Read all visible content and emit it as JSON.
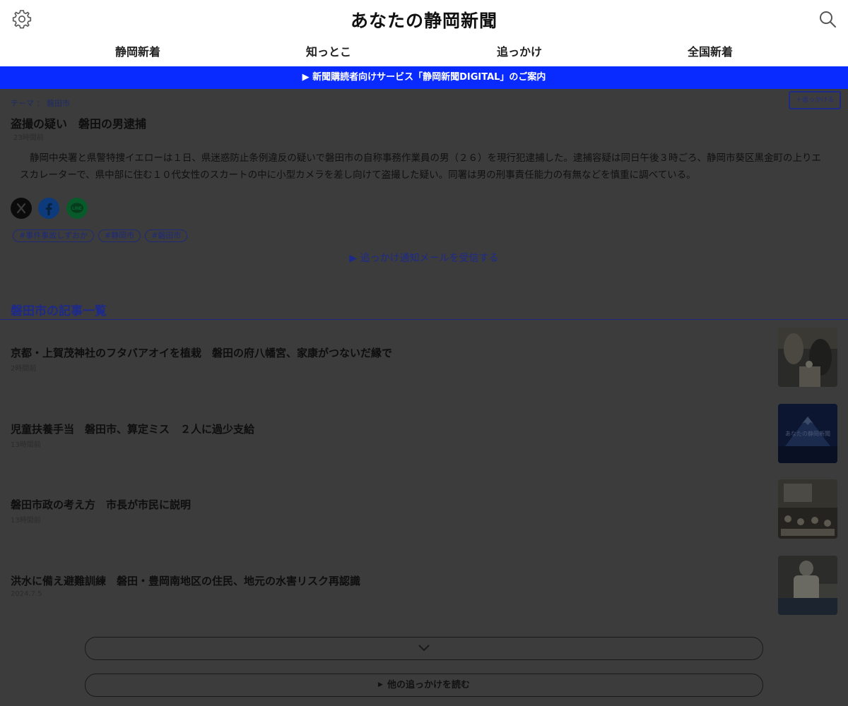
{
  "header": {
    "title": "あなたの静岡新聞",
    "settings_icon": "gear-icon",
    "search_icon": "search-icon"
  },
  "nav": {
    "items": [
      {
        "label": "静岡新着"
      },
      {
        "label": "知っとこ"
      },
      {
        "label": "追っかけ"
      },
      {
        "label": "全国新着"
      }
    ]
  },
  "banner": {
    "text": "▶ 新聞購読者向けサービス「静岡新聞DIGITAL」のご案内"
  },
  "article": {
    "breadcrumb": {
      "theme_label": "テーマ",
      "separator": "：",
      "theme": "磐田市"
    },
    "follow_label": "＋追っかける",
    "title": "盗撮の疑い　磐田の男逮捕",
    "time": "23時間前",
    "body": "静岡中央署と県警特捜イエローは１日、県迷惑防止条例違反の疑いで磐田市の自称事務作業員の男（２６）を現行犯逮捕した。逮捕容疑は同日午後３時ごろ、静岡市葵区黒金町の上りエスカレーターで、県中部に住む１０代女性のスカートの中に小型カメラを差し向けて盗撮した疑い。同署は男の刑事責任能力の有無などを慎重に調べている。",
    "share": [
      {
        "name": "x-icon"
      },
      {
        "name": "facebook-icon"
      },
      {
        "name": "line-icon",
        "label": "LINE"
      }
    ],
    "tags": [
      "#事件事故しずおか",
      "#静岡市",
      "#磐田市"
    ],
    "notify_link": "▶ 追っかけ通知メールを受信する"
  },
  "section": {
    "title": "磐田市の記事一覧"
  },
  "list": {
    "items": [
      {
        "title": "京都・上賀茂神社のフタバアオイを植栽　磐田の府八幡宮、家康がつないだ縁で",
        "time": "2時間前"
      },
      {
        "title": "児童扶養手当　磐田市、算定ミス　２人に過少支給",
        "time": "13時間前"
      },
      {
        "title": "磐田市政の考え方　市長が市民に説明",
        "time": "13時間前"
      },
      {
        "title": "洪水に備え避難訓練　磐田・豊岡南地区の住民、地元の水害リスク再認識",
        "time": "2024.7.5"
      }
    ],
    "thumb_placeholder_text": "あなたの静岡新聞"
  },
  "buttons": {
    "more_icon": "chevron-down-icon",
    "other_label": "他の追っかけを読む"
  },
  "colors": {
    "brand_blue": "#0a2bff",
    "overlay": "#3c3c3c",
    "link_dark_blue": "#1e2a8a"
  }
}
